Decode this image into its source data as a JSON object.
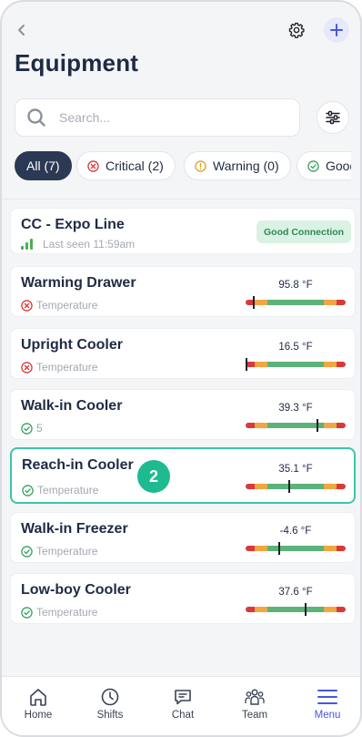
{
  "header": {
    "title": "Equipment"
  },
  "search": {
    "placeholder": "Search..."
  },
  "filters": [
    {
      "label": "All (7)",
      "active": true
    },
    {
      "label": "Critical (2)",
      "icon": "critical-icon"
    },
    {
      "label": "Warning (0)",
      "icon": "warning-icon"
    },
    {
      "label": "Good",
      "icon": "good-icon"
    }
  ],
  "connection": {
    "name": "CC - Expo Line",
    "last_seen": "Last seen 11:59am",
    "status": "Good Connection"
  },
  "equipment": [
    {
      "name": "Warming Drawer",
      "status": "critical",
      "sub": "Temperature",
      "reading": "95.8 °F",
      "level": 0.07
    },
    {
      "name": "Upright Cooler",
      "status": "critical",
      "sub": "Temperature",
      "reading": "16.5 °F",
      "level": 0.0
    },
    {
      "name": "Walk-in Cooler",
      "status": "good",
      "sub": "5",
      "reading": "39.3 °F",
      "level": 0.71
    },
    {
      "name": "Reach-in Cooler",
      "status": "good",
      "sub": "Temperature",
      "reading": "35.1 °F",
      "level": 0.43,
      "badge": "2"
    },
    {
      "name": "Walk-in Freezer",
      "status": "good",
      "sub": "Temperature",
      "reading": "-4.6 °F",
      "level": 0.33
    },
    {
      "name": "Low-boy Cooler",
      "status": "good",
      "sub": "Temperature",
      "reading": "37.6 °F",
      "level": 0.59
    }
  ],
  "tabs": [
    {
      "label": "Home",
      "icon": "home-icon"
    },
    {
      "label": "Shifts",
      "icon": "clock-icon"
    },
    {
      "label": "Chat",
      "icon": "chat-icon"
    },
    {
      "label": "Team",
      "icon": "team-icon"
    },
    {
      "label": "Menu",
      "icon": "menu-icon",
      "active": true
    }
  ],
  "colors": {
    "accent": "#4b56d9",
    "critical": "#d83a3a",
    "warning": "#f2a642",
    "good": "#5bb37a",
    "selected_border": "#3cc6a8"
  }
}
